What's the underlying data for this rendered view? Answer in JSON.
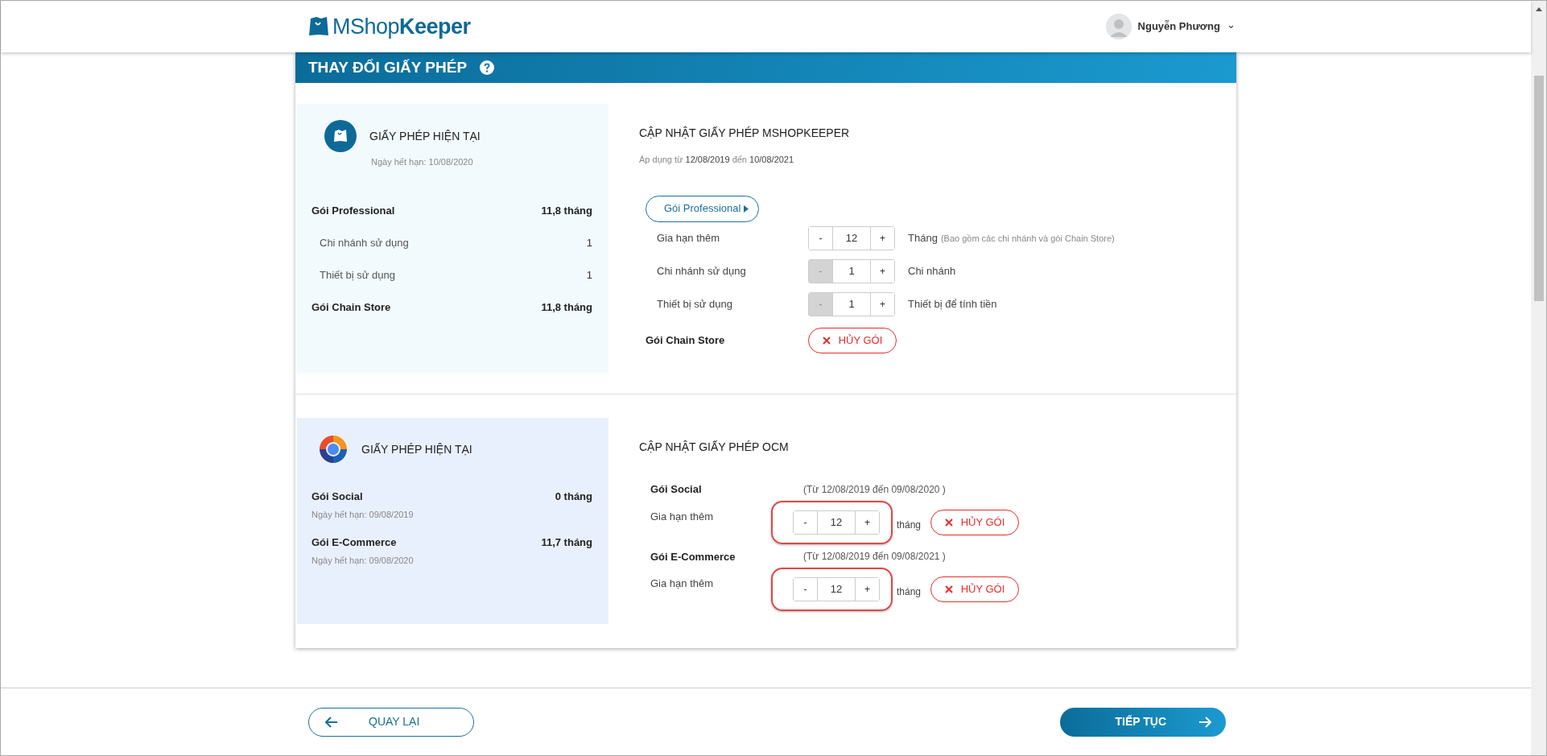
{
  "header": {
    "logo": "MShop**Keeper**",
    "user": {
      "name": "Nguyễn Phương",
      "caret": "⌄"
    }
  },
  "page_title": "THAY ĐỔI GIẤY PHÉP",
  "sections": [
    {
      "kind": "mshopkeeper",
      "current": {
        "title": "GIẤY PHÉP HIỆN TẠI",
        "expiry": "Ngày hết hạn: 10/08/2020",
        "rows": [
          {
            "kind": "main",
            "label": "Gói Professional",
            "value": "11,8 tháng"
          },
          {
            "kind": "sub",
            "label": "Chi nhánh sử dụng",
            "value": "1"
          },
          {
            "kind": "sub",
            "label": "Thiết bị sử dụng",
            "value": "1"
          },
          {
            "kind": "main",
            "label": "Gói Chain Store",
            "value": "11,8 tháng"
          }
        ]
      },
      "update": {
        "title": "CẬP NHẬT GIẤY PHÉP MSHOPKEEPER",
        "applied": "Áp dụng từ **12/08/2019** đến **10/08/2021**",
        "package_button": "Gói Professional",
        "steppers": [
          {
            "label": "Gia hạn thêm",
            "minus": "-",
            "value": "12",
            "plus": "+",
            "minus_disabled": false,
            "unit": "Tháng",
            "note": "(Bao gồm các chi nhánh và gói Chain Store)"
          },
          {
            "label": "Chi nhánh sử dụng",
            "minus": "-",
            "value": "1",
            "plus": "+",
            "minus_disabled": true,
            "unit": "Chi nhánh"
          },
          {
            "label": "Thiết bị sử dụng",
            "minus": "-",
            "value": "1",
            "plus": "+",
            "minus_disabled": true,
            "unit": "Thiết bị để tính tiền"
          }
        ],
        "addon": {
          "label": "Gói Chain Store",
          "cancel": "HỦY GÓI"
        }
      }
    },
    {
      "kind": "ocm",
      "current": {
        "title": "GIẤY PHÉP HIỆN TẠI",
        "rows": [
          {
            "label": "Gói Social",
            "value": "0 tháng",
            "expiry": "Ngày hết hạn: 09/08/2019"
          },
          {
            "label": "Gói E-Commerce",
            "value": "11,7 tháng",
            "expiry": "Ngày hết hạn: 09/08/2020"
          }
        ]
      },
      "update": {
        "title": "CẬP NHẬT GIẤY PHÉP OCM",
        "packages": [
          {
            "name": "Gói Social",
            "period": "(Từ 12/08/2019 đến 09/08/2020 )",
            "extend_label": "Gia hạn thêm",
            "minus": "-",
            "value": "12",
            "plus": "+",
            "highlighted": true,
            "unit": "tháng",
            "cancel": "HỦY GÓI"
          },
          {
            "name": "Gói E-Commerce",
            "period": "(Từ 12/08/2019 đến 09/08/2021 )",
            "extend_label": "Gia hạn thêm",
            "minus": "-",
            "value": "12",
            "plus": "+",
            "highlighted": true,
            "unit": "tháng",
            "cancel": "HỦY GÓI"
          }
        ]
      }
    }
  ],
  "footer": {
    "back": "QUAY LẠI",
    "next": "TIẾP TỤC"
  }
}
